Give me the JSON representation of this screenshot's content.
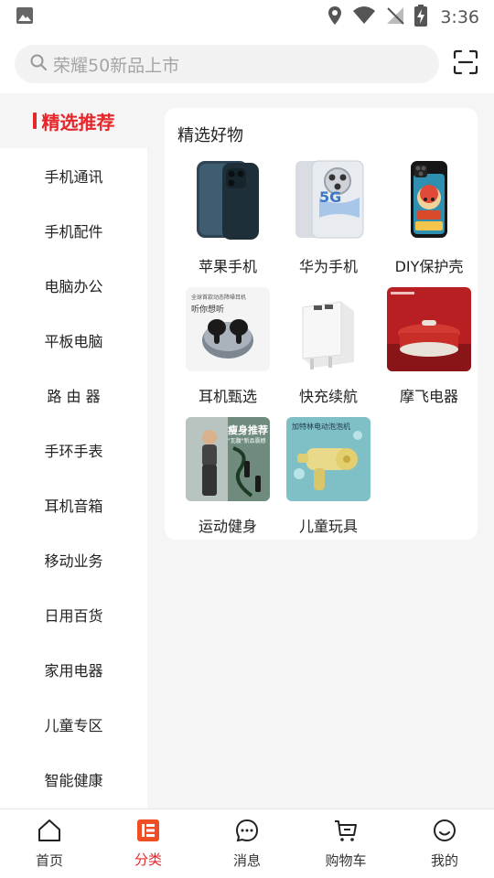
{
  "status_bar": {
    "time": "3:36",
    "icons": [
      "image-icon",
      "location-icon",
      "wifi-icon",
      "no-signal-icon",
      "battery-charging-icon"
    ]
  },
  "search": {
    "placeholder": "荣耀50新品上市",
    "scan_icon": "scan-icon"
  },
  "sidebar": {
    "active_label": "精选推荐",
    "items": [
      {
        "label": "手机通讯"
      },
      {
        "label": "手机配件"
      },
      {
        "label": "电脑办公"
      },
      {
        "label": "平板电脑"
      },
      {
        "label": "路 由 器"
      },
      {
        "label": "手环手表"
      },
      {
        "label": "耳机音箱"
      },
      {
        "label": "移动业务"
      },
      {
        "label": "日用百货"
      },
      {
        "label": "家用电器"
      },
      {
        "label": "儿童专区"
      },
      {
        "label": "智能健康"
      }
    ]
  },
  "content": {
    "title": "精选好物",
    "items": [
      {
        "label": "苹果手机"
      },
      {
        "label": "华为手机"
      },
      {
        "label": "DIY保护壳"
      },
      {
        "label": "耳机甄选"
      },
      {
        "label": "快充续航"
      },
      {
        "label": "摩飞电器"
      },
      {
        "label": "运动健身"
      },
      {
        "label": "儿童玩具"
      }
    ],
    "thumb_texts": {
      "huawei_badge": "5G",
      "earbuds_line1": "全球首款动态降噪耳机",
      "earbuds_line2": "听你想听",
      "fitness_title": "瘦身推荐",
      "fitness_sub": "\"瓦腹\"新品震撼",
      "toy_line": "加特林电动泡泡机"
    }
  },
  "tab_bar": {
    "accent": "#e5262b",
    "tabs": [
      {
        "label": "首页",
        "icon": "home-icon"
      },
      {
        "label": "分类",
        "icon": "category-icon"
      },
      {
        "label": "消息",
        "icon": "message-icon"
      },
      {
        "label": "购物车",
        "icon": "cart-icon"
      },
      {
        "label": "我的",
        "icon": "profile-icon"
      }
    ]
  }
}
